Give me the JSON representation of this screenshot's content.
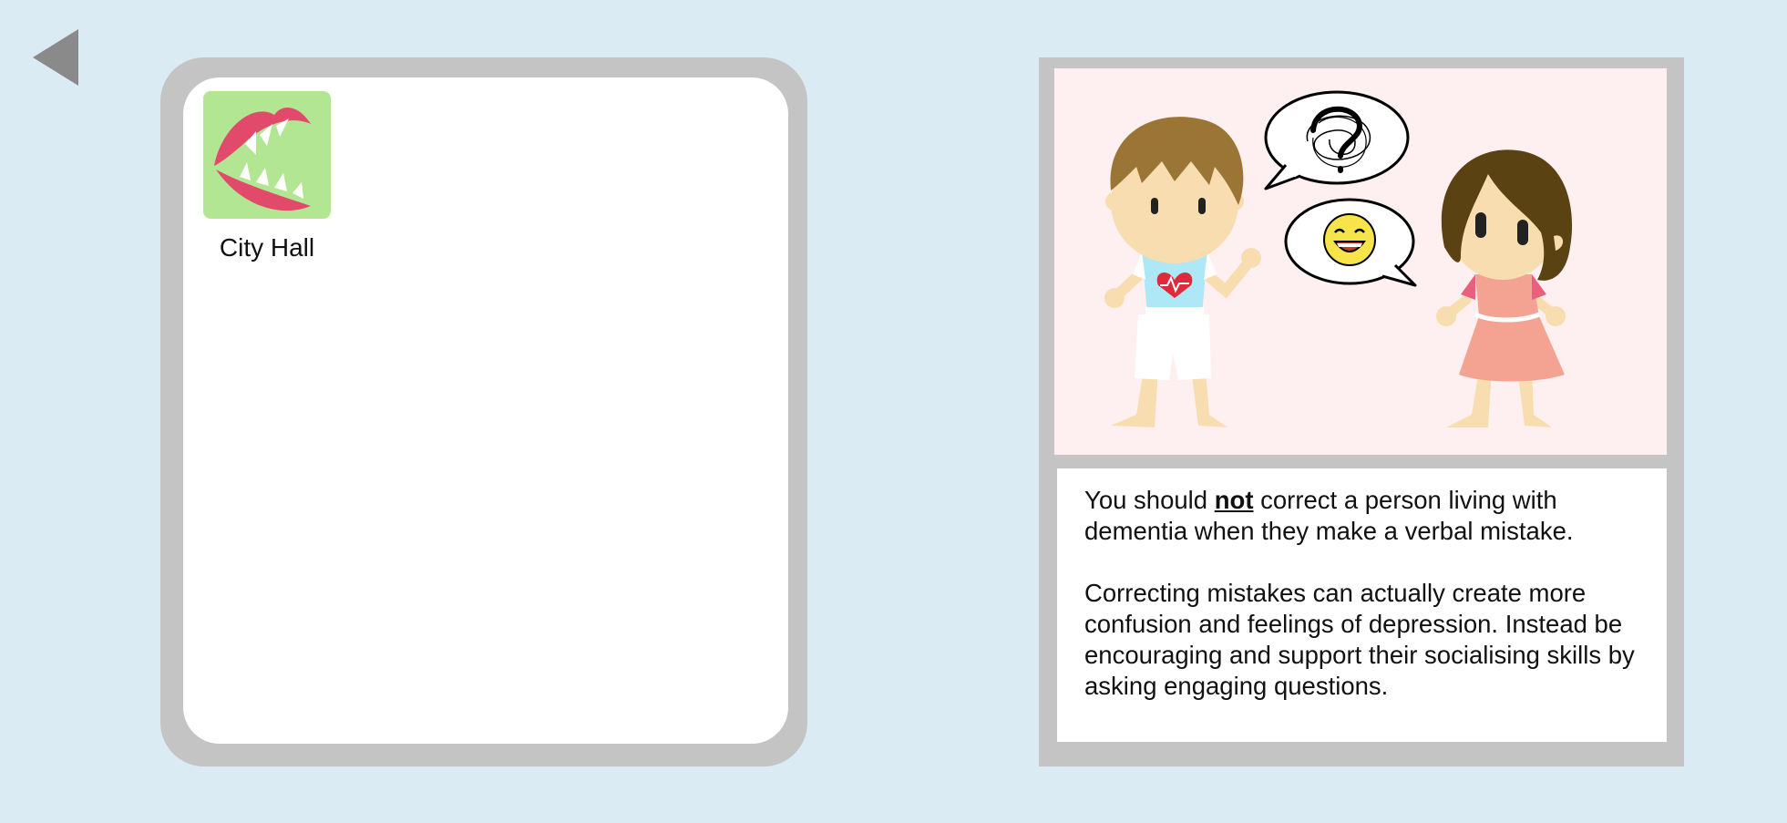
{
  "nav": {
    "back_icon": "triangle-left-icon"
  },
  "choices": [
    {
      "label": "City Hall",
      "icon": "mouth-with-teeth-icon"
    }
  ],
  "info": {
    "p1_before": "You should ",
    "p1_emphasis": "not",
    "p1_after": " correct a person living with dementia when they make a verbal mistake.",
    "p2": "Correcting mistakes can actually create more confusion and feelings of depression. Instead be encouraging and support their socialising skills by asking engaging questions."
  },
  "colors": {
    "background": "#dbebf3",
    "panel_frame": "#c4c4c4",
    "tile_green": "#b3e693",
    "lips_pink": "#e24a6c",
    "picture_bg": "#fef0f0"
  }
}
